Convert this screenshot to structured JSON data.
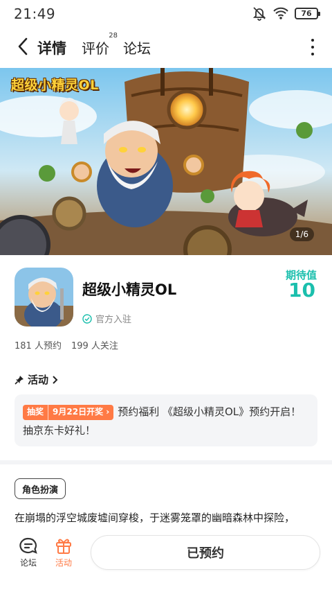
{
  "status_bar": {
    "time": "21:49",
    "battery": "76",
    "icons": [
      "mute-bell-icon",
      "wifi-icon",
      "battery-icon"
    ]
  },
  "nav": {
    "back_icon": "chevron-left-icon",
    "tabs": [
      {
        "label": "详情",
        "active": true
      },
      {
        "label": "评价",
        "badge": "28"
      },
      {
        "label": "论坛"
      }
    ],
    "more_icon": "more-vertical-icon"
  },
  "banner": {
    "logo_text": "超级小精灵OL",
    "counter": "1/6"
  },
  "app": {
    "name": "超级小精灵OL",
    "official": "官方入驻",
    "expect_label": "期待值",
    "expect_value": "10",
    "reservations": "181 人预约",
    "followers": "199 人关注"
  },
  "activity": {
    "title": "活动",
    "tag_label": "抽奖",
    "tag_date": "9月22日开奖 ›",
    "text": "预约福利 《超级小精灵OL》预约开启！抽京东卡好礼！"
  },
  "genre": "角色扮演",
  "description": "在崩塌的浮空城废墟间穿梭，于迷雾笼罩的幽暗森林中探险，",
  "bottom": {
    "forum_label": "论坛",
    "activity_label": "活动",
    "reserve_button": "已预约"
  },
  "colors": {
    "accent": "#1bbfad",
    "tab_underline": "#2bd0c0",
    "orange": "#ff7a45"
  }
}
